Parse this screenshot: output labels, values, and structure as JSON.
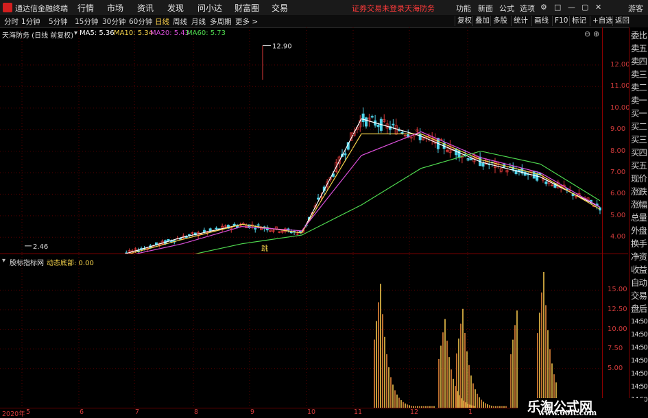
{
  "titlebar": {
    "app_title": "通达信金融终端",
    "menu": [
      "行情",
      "市场",
      "资讯",
      "发现",
      "问小达",
      "财富圈",
      "交易"
    ],
    "warning": "证券交易未登录",
    "stock": "天海防务",
    "right_menu": [
      "功能",
      "新面",
      "公式",
      "选项"
    ],
    "user": "游客",
    "controls": [
      "⚙",
      "□",
      "—",
      "▢",
      "✕"
    ]
  },
  "toolbar": {
    "periods": [
      "分时",
      "1分钟",
      "5分钟",
      "15分钟",
      "30分钟",
      "60分钟",
      "日线",
      "周线",
      "月线",
      "多周期",
      "更多 >"
    ],
    "active_period": "日线",
    "right_buttons": [
      "复权",
      "叠加",
      "多股",
      "统计",
      "画线",
      "F10",
      "标记",
      "+自选",
      "返回"
    ]
  },
  "price_panel": {
    "header": "天海防务 (日线 前复权)",
    "ma": [
      {
        "label": "MA5: 5.36",
        "color": "#ffffff"
      },
      {
        "label": "MA10: 5.34",
        "color": "#f5d34b"
      },
      {
        "label": "MA20: 5.43",
        "color": "#d94fd9"
      },
      {
        "label": "MA60: 5.73",
        "color": "#4fd94f"
      }
    ],
    "high_label": "12.90",
    "low_label": "2.46",
    "marker": "跳",
    "y_axis": [
      "12.00",
      "11.00",
      "10.00",
      "9.00",
      "8.00",
      "7.00",
      "6.00",
      "5.00",
      "4.00"
    ],
    "y_range": [
      3.5,
      13.3
    ]
  },
  "indicator_panel": {
    "name": "股标指标网",
    "value_label": "动态底部: 0.00",
    "y_axis": [
      "15.00",
      "12.50",
      "10.00",
      "7.50",
      "5.00"
    ],
    "y_range": [
      0,
      18
    ]
  },
  "x_axis": [
    "2020年",
    "5",
    "6",
    "7",
    "8",
    "9",
    "10",
    "11",
    "12",
    "1"
  ],
  "sidebar": [
    "委比",
    "卖五",
    "卖四",
    "卖三",
    "卖二",
    "卖一",
    "买一",
    "买二",
    "买三",
    "买四",
    "买五",
    "现价",
    "涨跌",
    "涨幅",
    "总量",
    "外盘",
    "换手",
    "净资",
    "收益",
    "自动",
    "交易",
    "盘后",
    "14:50",
    "14:50",
    "14:50",
    "14:50",
    "14:50",
    "14:50",
    "14:50"
  ],
  "watermark": {
    "cn": "乐淘公式网",
    "url": "www.60lt.com"
  },
  "chart_data": {
    "type": "line",
    "title": "天海防务 (日线 前复权)",
    "x": [
      "2020年",
      "5",
      "6",
      "7",
      "8",
      "9",
      "10",
      "11",
      "12",
      "1"
    ],
    "series": [
      {
        "name": "MA5",
        "values": [
          2.6,
          2.9,
          3.2,
          4.0,
          4.6,
          4.2,
          9.5,
          8.7,
          7.5,
          6.8,
          5.4
        ]
      },
      {
        "name": "MA10",
        "values": [
          2.6,
          2.85,
          3.15,
          3.9,
          4.6,
          4.2,
          8.8,
          8.8,
          7.6,
          6.9,
          5.3
        ]
      },
      {
        "name": "MA20",
        "values": [
          2.6,
          2.8,
          3.1,
          3.7,
          4.5,
          4.3,
          7.8,
          8.9,
          7.7,
          7.0,
          5.4
        ]
      },
      {
        "name": "MA60",
        "values": [
          2.6,
          2.65,
          2.8,
          3.1,
          3.7,
          4.1,
          5.5,
          7.2,
          8.0,
          7.4,
          5.7
        ]
      }
    ],
    "ylim": [
      3.5,
      13.3
    ],
    "high": 12.9,
    "low": 2.46
  }
}
